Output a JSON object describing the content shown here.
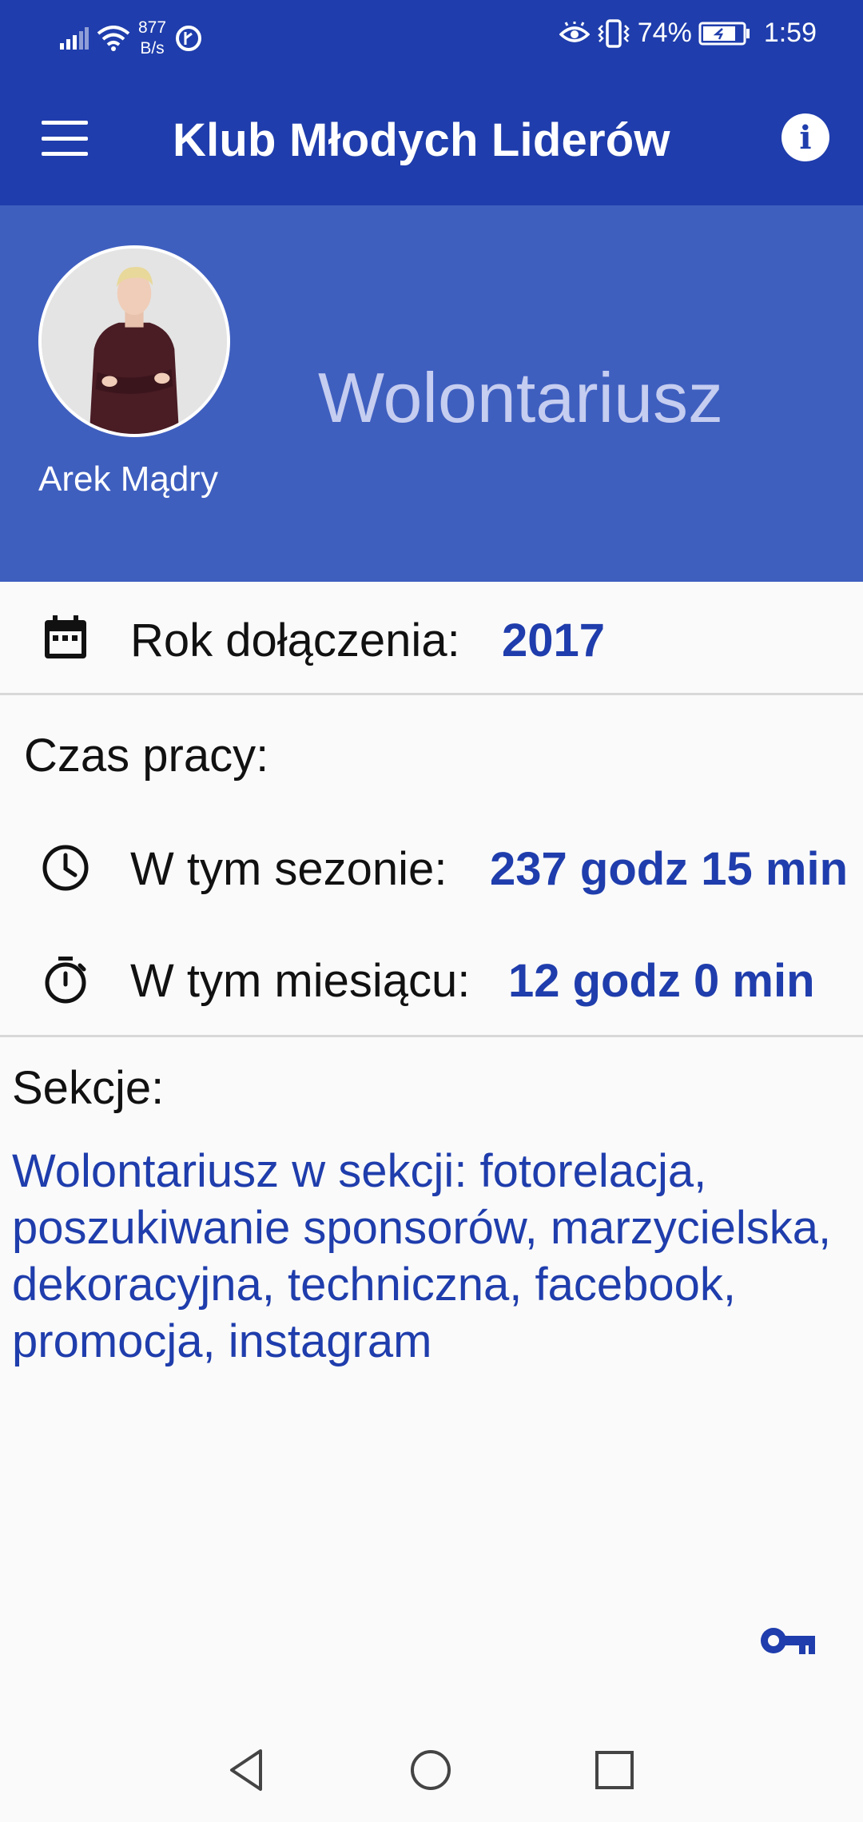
{
  "status_bar": {
    "net_speed_value": "877",
    "net_speed_unit": "B/s",
    "battery": "74%",
    "time": "1:59"
  },
  "app_bar": {
    "title": "Klub Młodych Liderów"
  },
  "profile": {
    "name": "Arek Mądry",
    "role": "Wolontariusz"
  },
  "join": {
    "label": "Rok dołączenia:",
    "value": "2017"
  },
  "work_time": {
    "heading": "Czas pracy:",
    "season_label": "W tym sezonie:",
    "season_value": "237 godz 15 min",
    "month_label": "W tym miesiącu:",
    "month_value": "12 godz 0 min"
  },
  "sections": {
    "heading": "Sekcje:",
    "text": "Wolontariusz w sekcji: fotorelacja, poszukiwanie sponsorów, marzycielska, dekoracyjna, techniczna, facebook, promocja, instagram"
  },
  "colors": {
    "primary": "#1f3dac",
    "header": "#3f5fbf",
    "role_text": "#c5cdf0"
  },
  "icons": [
    "signal-icon",
    "wifi-icon",
    "data-saver-icon",
    "eye-comfort-icon",
    "vibrate-icon",
    "battery-icon",
    "menu-icon",
    "info-icon",
    "calendar-icon",
    "clock-icon",
    "stopwatch-icon",
    "key-icon",
    "back-icon",
    "home-icon",
    "recents-icon"
  ]
}
